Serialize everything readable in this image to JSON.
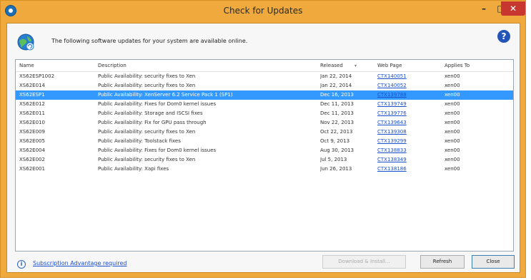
{
  "window": {
    "title": "Check for Updates",
    "minimize_glyph": "–",
    "maximize_glyph": "□",
    "close_glyph": "✕"
  },
  "header": {
    "message": "The following software updates for your system are available online.",
    "help_glyph": "?"
  },
  "table": {
    "columns": {
      "name": "Name",
      "description": "Description",
      "released": "Released",
      "sort_indicator": "▾",
      "web_page": "Web Page",
      "applies_to": "Applies To"
    },
    "rows": [
      {
        "name": "XS62ESP1002",
        "description": "Public Availability: security fixes to Xen",
        "released": "Jan 22, 2014",
        "web_page": "CTX140051",
        "applies_to": "xen00"
      },
      {
        "name": "XS62E014",
        "description": "Public Availability: security fixes to Xen",
        "released": "Jan 22, 2014",
        "web_page": "CTX140052",
        "applies_to": "xen00"
      },
      {
        "name": "XS62ESP1",
        "description": "Public Availability: XenServer 6.2 Service Pack 1 (SP1)",
        "released": "Dec 16, 2013",
        "web_page": "CTX139788",
        "applies_to": "xen00"
      },
      {
        "name": "XS62E012",
        "description": "Public Availability: Fixes for Dom0 kernel issues",
        "released": "Dec 11, 2013",
        "web_page": "CTX139749",
        "applies_to": "xen00"
      },
      {
        "name": "XS62E011",
        "description": "Public Availability: Storage and ISCSI fixes",
        "released": "Dec 11, 2013",
        "web_page": "CTX139776",
        "applies_to": "xen00"
      },
      {
        "name": "XS62E010",
        "description": "Public Availability: Fix for GPU pass through",
        "released": "Nov 22, 2013",
        "web_page": "CTX139643",
        "applies_to": "xen00"
      },
      {
        "name": "XS62E009",
        "description": "Public Availability: security fixes to Xen",
        "released": "Oct 22, 2013",
        "web_page": "CTX139308",
        "applies_to": "xen00"
      },
      {
        "name": "XS62E005",
        "description": "Public Availability: Toolstack fixes",
        "released": "Oct 9, 2013",
        "web_page": "CTX139299",
        "applies_to": "xen00"
      },
      {
        "name": "XS62E004",
        "description": "Public Availability: Fixes for Dom0 kernel issues",
        "released": "Aug 30, 2013",
        "web_page": "CTX138833",
        "applies_to": "xen00"
      },
      {
        "name": "XS62E002",
        "description": "Public Availability: security fixes to Xen",
        "released": "Jul 5, 2013",
        "web_page": "CTX138349",
        "applies_to": "xen00"
      },
      {
        "name": "XS62E001",
        "description": "Public Availability: Xapi fixes",
        "released": "Jun 26, 2013",
        "web_page": "CTX138186",
        "applies_to": "xen00"
      }
    ]
  },
  "footer": {
    "info_glyph": "i",
    "subscription_link": "Subscription Advantage required",
    "download_button": "Download & Install...",
    "refresh_button": "Refresh",
    "close_button": "Close"
  }
}
